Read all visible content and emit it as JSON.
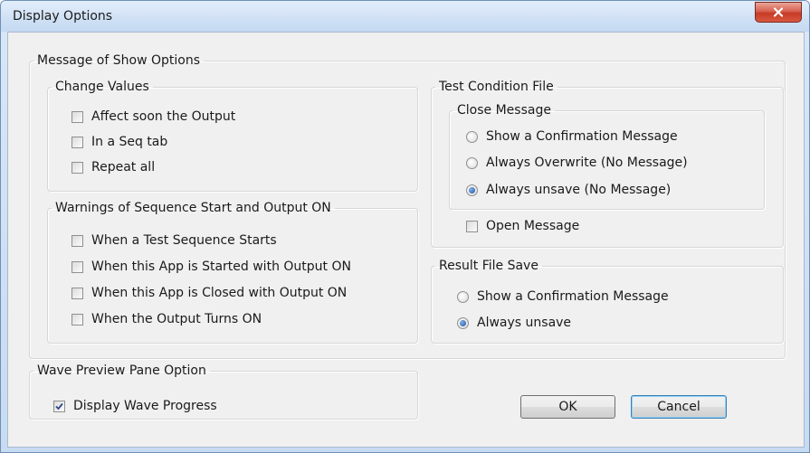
{
  "window": {
    "title": "Display Options"
  },
  "message_options": {
    "legend": "Message of Show Options",
    "change_values": {
      "legend": "Change Values",
      "items": [
        {
          "label": "Affect soon the Output",
          "checked": false
        },
        {
          "label": "In a Seq tab",
          "checked": false
        },
        {
          "label": "Repeat all",
          "checked": false
        }
      ]
    },
    "warnings": {
      "legend": "Warnings of Sequence Start and Output ON",
      "items": [
        {
          "label": "When a Test Sequence Starts",
          "checked": false
        },
        {
          "label": "When this App is Started with Output ON",
          "checked": false
        },
        {
          "label": "When this App is Closed with Output ON",
          "checked": false
        },
        {
          "label": "When the Output Turns ON",
          "checked": false
        }
      ]
    },
    "test_condition_file": {
      "legend": "Test Condition File",
      "close_message": {
        "legend": "Close Message",
        "options": [
          {
            "label": "Show a Confirmation Message",
            "selected": false
          },
          {
            "label": "Always Overwrite (No Message)",
            "selected": false
          },
          {
            "label": "Always unsave (No Message)",
            "selected": true
          }
        ]
      },
      "open_message": {
        "label": "Open Message",
        "checked": false
      }
    },
    "result_file_save": {
      "legend": "Result File Save",
      "options": [
        {
          "label": "Show a Confirmation Message",
          "selected": false
        },
        {
          "label": "Always unsave",
          "selected": true
        }
      ]
    }
  },
  "wave_preview": {
    "legend": "Wave Preview Pane Option",
    "display_wave_progress": {
      "label": "Display Wave Progress",
      "checked": true
    }
  },
  "buttons": {
    "ok": "OK",
    "cancel": "Cancel"
  },
  "colors": {
    "title_bar": "#cfe0f5",
    "close_button": "#c63b27",
    "dialog_bg": "#f0f0f0",
    "radio_dot": "#1e4f9c"
  }
}
